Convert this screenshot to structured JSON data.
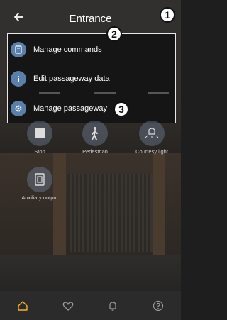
{
  "header": {
    "title": "Entrance",
    "back_icon": "back-arrow-icon"
  },
  "callouts": {
    "one": "1",
    "two": "2",
    "three": "3"
  },
  "menu": {
    "items": [
      {
        "label": "Manage commands",
        "icon": "list-icon"
      },
      {
        "label": "Edit passageway data",
        "icon": "info-icon"
      },
      {
        "label": "Manage passageway",
        "icon": "gear-icon"
      }
    ]
  },
  "actions": [
    {
      "label": "Stop",
      "icon": "stop-icon"
    },
    {
      "label": "Pedestrian",
      "icon": "pedestrian-icon"
    },
    {
      "label": "Courtesy light",
      "icon": "light-icon"
    },
    {
      "label": "Auxiliary output",
      "icon": "auxiliary-output-icon"
    }
  ],
  "bottom_nav": {
    "items": [
      {
        "icon": "home-icon",
        "active": true
      },
      {
        "icon": "heart-icon",
        "active": false
      },
      {
        "icon": "bell-icon",
        "active": false
      },
      {
        "icon": "help-icon",
        "active": false
      }
    ]
  },
  "colors": {
    "accent": "#f2b233",
    "menu_icon_bg": "#5a7fa8",
    "inactive_nav": "#9a9a9a"
  }
}
